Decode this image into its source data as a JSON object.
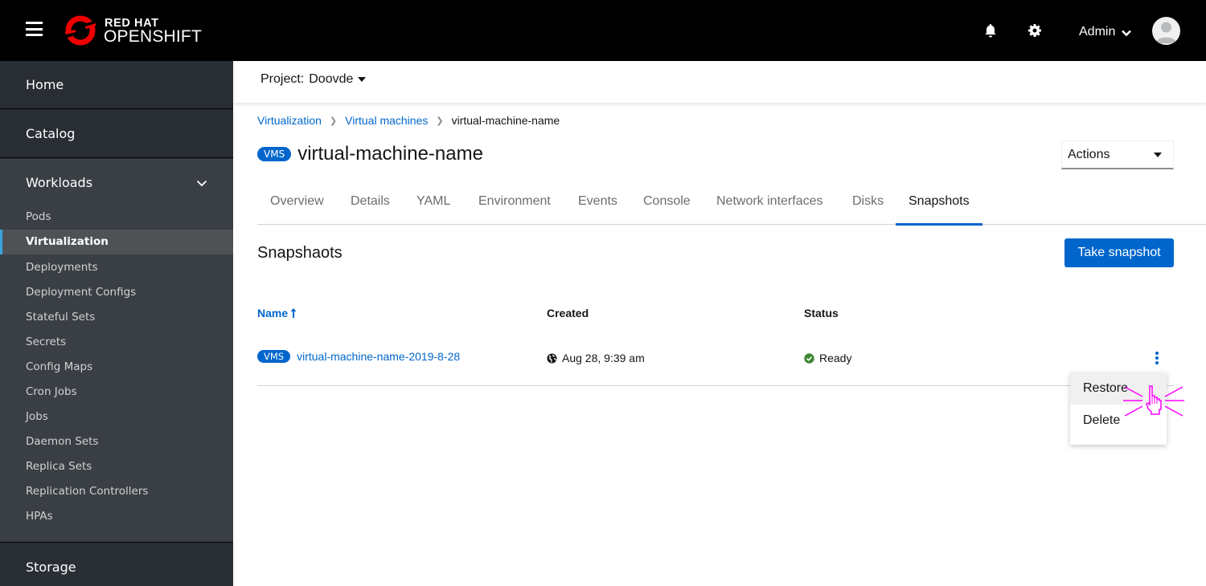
{
  "masthead": {
    "brand_line1": "RED HAT",
    "brand_line2": "OPENSHIFT",
    "user_label": "Admin",
    "icons": [
      "hamburger-icon",
      "bell-icon",
      "gear-icon",
      "chevron-down-icon",
      "avatar"
    ]
  },
  "sidebar": {
    "sections": [
      {
        "label": "Home"
      },
      {
        "label": "Catalog"
      },
      {
        "label": "Workloads",
        "expanded": true
      },
      {
        "label": "Storage"
      }
    ],
    "workloads_items": [
      {
        "label": "Pods",
        "active": false
      },
      {
        "label": "Virtualization",
        "active": true
      },
      {
        "label": "Deployments",
        "active": false
      },
      {
        "label": "Deployment Configs",
        "active": false
      },
      {
        "label": "Stateful Sets",
        "active": false
      },
      {
        "label": "Secrets",
        "active": false
      },
      {
        "label": "Config Maps",
        "active": false
      },
      {
        "label": "Cron Jobs",
        "active": false
      },
      {
        "label": "Jobs",
        "active": false
      },
      {
        "label": "Daemon Sets",
        "active": false
      },
      {
        "label": "Replica Sets",
        "active": false
      },
      {
        "label": "Replication Controllers",
        "active": false
      },
      {
        "label": "HPAs",
        "active": false
      }
    ]
  },
  "project": {
    "label": "Project:",
    "value": "Doovde"
  },
  "breadcrumb": [
    {
      "label": "Virtualization",
      "link": true
    },
    {
      "label": "Virtual machines",
      "link": true
    },
    {
      "label": "virtual-machine-name",
      "link": false
    }
  ],
  "page": {
    "badge": "VMS",
    "title": "virtual-machine-name",
    "actions_label": "Actions"
  },
  "tabs": [
    {
      "label": "Overview",
      "active": false
    },
    {
      "label": "Details",
      "active": false
    },
    {
      "label": "YAML",
      "active": false
    },
    {
      "label": "Environment",
      "active": false
    },
    {
      "label": "Events",
      "active": false
    },
    {
      "label": "Console",
      "active": false
    },
    {
      "label": "Network interfaces",
      "active": false
    },
    {
      "label": "Disks",
      "active": false
    },
    {
      "label": "Snapshots",
      "active": true
    }
  ],
  "snapshots": {
    "section_title": "Snapshaots",
    "take_snapshot_label": "Take snapshot",
    "columns": {
      "name": "Name",
      "created": "Created",
      "status": "Status"
    },
    "sort": {
      "column": "name",
      "direction": "ascending"
    },
    "rows": [
      {
        "badge": "VMS",
        "name": "virtual-machine-name-2019-8-28",
        "created": "Aug 28, 9:39 am",
        "status": "Ready"
      }
    ],
    "row_menu": {
      "open": true,
      "items": [
        {
          "label": "Restore",
          "hovered": true
        },
        {
          "label": "Delete",
          "hovered": false
        }
      ]
    }
  },
  "colors": {
    "masthead_bg": "#000000",
    "sidebar_bg": "#292e34",
    "sidebar_expanded_bg": "#393f44",
    "sidebar_active_bg": "#4f5255",
    "sidebar_active_indicator": "#39a5dc",
    "brand_red": "#ee0000",
    "link_blue": "#0066cc",
    "status_ready_green": "#3e8635",
    "cursor_highlight": "#ff00ff"
  }
}
